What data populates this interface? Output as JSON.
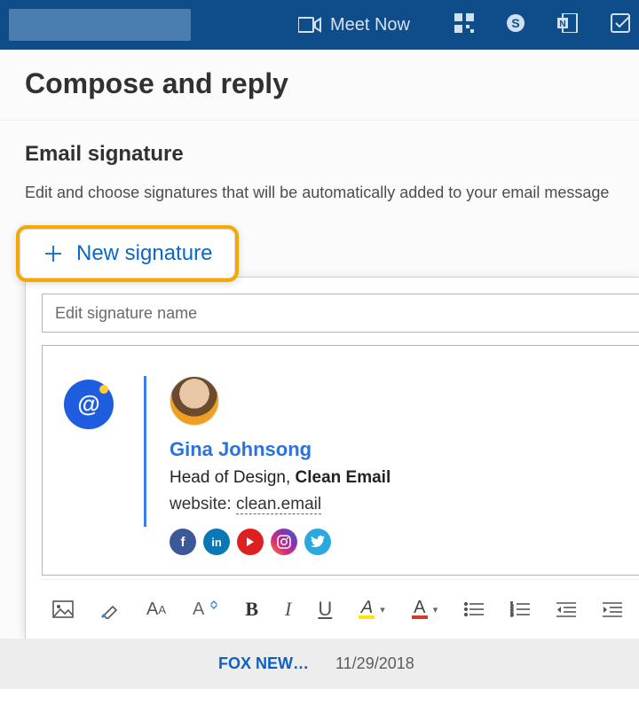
{
  "topbar": {
    "meet_now_label": "Meet Now"
  },
  "page": {
    "title": "Compose and reply"
  },
  "signature": {
    "section_title": "Email signature",
    "description": "Edit and choose signatures that will be automatically added to your email message",
    "new_button_label": "New signature",
    "name_placeholder": "Edit signature name",
    "preview": {
      "person_name": "Gina Johnsong",
      "role": "Head of Design, ",
      "company": "Clean Email",
      "website_prefix": "website: ",
      "website": "clean.email",
      "socials": [
        "facebook",
        "linkedin",
        "youtube",
        "instagram",
        "twitter"
      ]
    }
  },
  "toolbar": {
    "bold": "B",
    "italic": "I",
    "underline": "U",
    "highlight_letter": "A",
    "highlight_color": "#ffe600",
    "font_color_letter": "A",
    "font_color": "#d63a2a"
  },
  "background_item": {
    "title": "FOX NEW…",
    "date": "11/29/2018"
  }
}
